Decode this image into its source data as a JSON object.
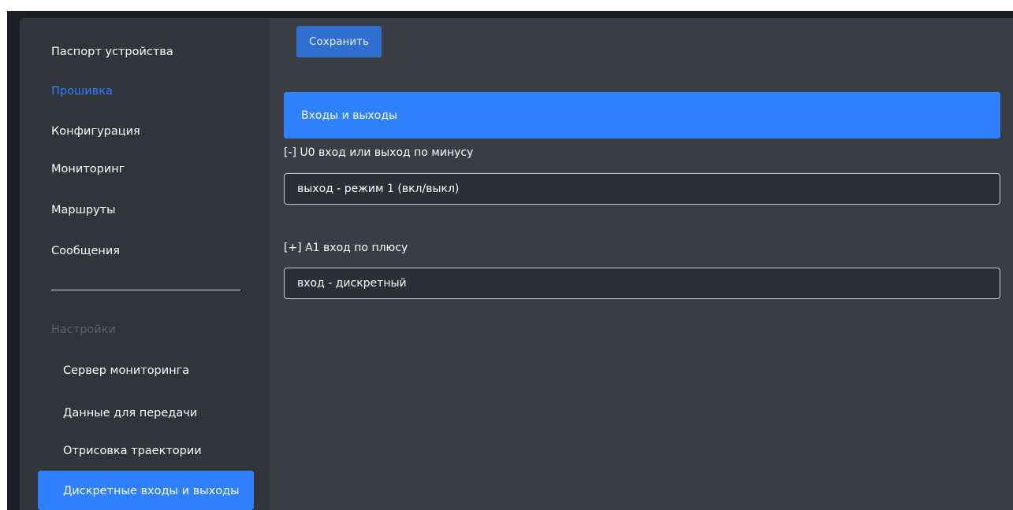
{
  "sidebar": {
    "items": [
      {
        "label": "Паспорт устройства"
      },
      {
        "label": "Прошивка"
      },
      {
        "label": "Конфигурация"
      },
      {
        "label": "Мониторинг"
      },
      {
        "label": "Маршруты"
      },
      {
        "label": "Сообщения"
      }
    ],
    "settings_label": "Настройки",
    "settings_items": [
      {
        "label": "Сервер мониторинга"
      },
      {
        "label": "Данные для передачи"
      },
      {
        "label": "Отрисовка траектории"
      },
      {
        "label": "Дискретные входы и выходы"
      }
    ]
  },
  "main": {
    "save_label": "Сохранить",
    "section_title": "Входы и выходы",
    "fields": [
      {
        "label": "[-] U0 вход или выход по минусу",
        "value": "выход - режим 1 (вкл/выкл)"
      },
      {
        "label": "[+] A1 вход по плюсу",
        "value": "вход - дискретный"
      }
    ]
  },
  "colors": {
    "accent": "#2f80ff",
    "sidebar_bg": "#31343a",
    "content_bg": "#3a3d44",
    "muted_text": "#5b5f66"
  }
}
